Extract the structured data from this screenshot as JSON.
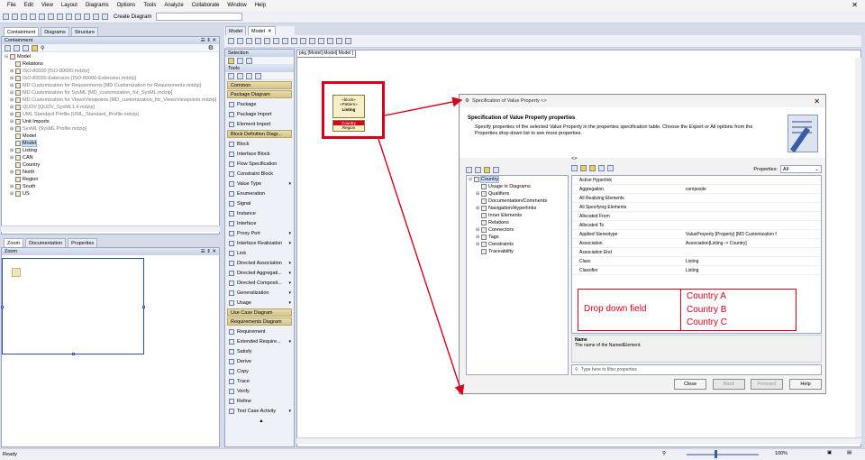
{
  "menu": [
    "File",
    "Edit",
    "View",
    "Layout",
    "Diagrams",
    "Options",
    "Tools",
    "Analyze",
    "Collaborate",
    "Window",
    "Help"
  ],
  "toolbar": {
    "create_diagram": "Create Diagram"
  },
  "left_tabs": [
    "Containment",
    "Diagrams",
    "Structure"
  ],
  "containment": {
    "title": "Containment",
    "tree": [
      {
        "label": "Model",
        "level": 0,
        "expander": "⊟"
      },
      {
        "label": "Relations",
        "level": 1,
        "expander": ""
      },
      {
        "label": "ISO-80000 [ISO-80000.mdzip]",
        "level": 1,
        "expander": "⊞",
        "gray": true
      },
      {
        "label": "ISO-80000-Extension [ISO-80000-Extension.mdzip]",
        "level": 1,
        "expander": "⊞",
        "gray": true
      },
      {
        "label": "MD Customization for Requirements [MD Customization for Requirements.mdzip]",
        "level": 1,
        "expander": "⊞",
        "gray": true
      },
      {
        "label": "MD Customization for SysML [MD_customization_for_SysML.mdzip]",
        "level": 1,
        "expander": "⊞",
        "gray": true
      },
      {
        "label": "MD Customization for ViewsViewpoints [MD_customization_for_ViewsViewpoints.mdzip]",
        "level": 1,
        "expander": "⊞",
        "gray": true
      },
      {
        "label": "QUDV [QUDV_SysML1.4.mdzip]",
        "level": 1,
        "expander": "⊞",
        "gray": true
      },
      {
        "label": "UML Standard Profile [UML_Standard_Profile.mdzip]",
        "level": 1,
        "expander": "⊞",
        "gray": true
      },
      {
        "label": "Unit Imports",
        "level": 1,
        "expander": "⊞"
      },
      {
        "label": "SysML [SysML Profile.mdzip]",
        "level": 1,
        "expander": "⊞",
        "gray": true
      },
      {
        "label": "Model",
        "level": 1,
        "expander": ""
      },
      {
        "label": "Model",
        "level": 1,
        "expander": "",
        "selected": true
      },
      {
        "label": "Listing",
        "level": 1,
        "expander": "⊞"
      },
      {
        "label": "CAN",
        "level": 1,
        "expander": "⊞"
      },
      {
        "label": "Country",
        "level": 1,
        "expander": ""
      },
      {
        "label": "North",
        "level": 1,
        "expander": "⊞"
      },
      {
        "label": "Region",
        "level": 1,
        "expander": ""
      },
      {
        "label": "South",
        "level": 1,
        "expander": "⊞"
      },
      {
        "label": "US",
        "level": 1,
        "expander": "⊞"
      }
    ]
  },
  "zoom_tabs": [
    "Zoom",
    "Documentation",
    "Properties"
  ],
  "zoom_panel": {
    "title": "Zoom"
  },
  "tools": {
    "selection_header": "Selection",
    "tools_header": "Tools",
    "items": [
      {
        "kind": "cat",
        "label": "Common"
      },
      {
        "kind": "cat",
        "label": "Package Diagram"
      },
      {
        "kind": "item",
        "label": "Package"
      },
      {
        "kind": "item",
        "label": "Package Import"
      },
      {
        "kind": "item",
        "label": "Element Import"
      },
      {
        "kind": "cat",
        "label": "Block Definition Diagr..."
      },
      {
        "kind": "item",
        "label": "Block"
      },
      {
        "kind": "item",
        "label": "Interface Block"
      },
      {
        "kind": "item",
        "label": "Flow Specification"
      },
      {
        "kind": "item",
        "label": "Constraint Block"
      },
      {
        "kind": "item",
        "label": "Value Type",
        "dd": true
      },
      {
        "kind": "item",
        "label": "Enumeration"
      },
      {
        "kind": "item",
        "label": "Signal"
      },
      {
        "kind": "item",
        "label": "Instance"
      },
      {
        "kind": "item",
        "label": "Interface"
      },
      {
        "kind": "item",
        "label": "Proxy Port",
        "dd": true
      },
      {
        "kind": "item",
        "label": "Interface Realization",
        "dd": true
      },
      {
        "kind": "item",
        "label": "Link"
      },
      {
        "kind": "item",
        "label": "Directed Association",
        "dd": true
      },
      {
        "kind": "item",
        "label": "Directed Aggregati...",
        "dd": true
      },
      {
        "kind": "item",
        "label": "Directed Composit...",
        "dd": true
      },
      {
        "kind": "item",
        "label": "Generalization",
        "dd": true
      },
      {
        "kind": "item",
        "label": "Usage",
        "dd": true
      },
      {
        "kind": "cat",
        "label": "Use Case Diagram"
      },
      {
        "kind": "cat",
        "label": "Requirements Diagram"
      },
      {
        "kind": "item",
        "label": "Requirement"
      },
      {
        "kind": "item",
        "label": "Extended Require...",
        "dd": true
      },
      {
        "kind": "item",
        "label": "Satisfy"
      },
      {
        "kind": "item",
        "label": "Derive"
      },
      {
        "kind": "item",
        "label": "Copy"
      },
      {
        "kind": "item",
        "label": "Trace"
      },
      {
        "kind": "item",
        "label": "Verify"
      },
      {
        "kind": "item",
        "label": "Refine"
      },
      {
        "kind": "item",
        "label": "Test Case Activity",
        "dd": true
      }
    ]
  },
  "doc_tabs": [
    "Model",
    "Model"
  ],
  "canvas": {
    "pkg_label": "pkg [Model] Model[ Model ]",
    "block1": {
      "stereo1": "«block»",
      "stereo2": "«Pattern»",
      "name": "Listing"
    },
    "block2": {
      "line1": "Country",
      "line2": "Region"
    }
  },
  "dialog": {
    "title": "Specification of Value Property <>",
    "heading": "Specification of Value Property properties",
    "description": "Specify properties of the selected Value Property in the properties specification table. Choose the Expert or All options from the Properties drop-down list to see more properties.",
    "breadcrumb": "<>",
    "properties_label": "Properties:",
    "properties_value": "All",
    "tree": [
      {
        "label": "Country",
        "selected": true,
        "exp": "⊟"
      },
      {
        "label": "Usage in Diagrams",
        "exp": ""
      },
      {
        "label": "Qualifiers",
        "exp": "⊞"
      },
      {
        "label": "Documentation/Comments",
        "exp": ""
      },
      {
        "label": "Navigation/Hyperlinks",
        "exp": "⊞"
      },
      {
        "label": "Inner Elements",
        "exp": ""
      },
      {
        "label": "Relations",
        "exp": ""
      },
      {
        "label": "Connectors",
        "exp": "⊞"
      },
      {
        "label": "Tags",
        "exp": "⊞"
      },
      {
        "label": "Constraints",
        "exp": "⊞"
      },
      {
        "label": "Traceability",
        "exp": ""
      }
    ],
    "props": [
      {
        "k": "Active Hyperlink",
        "v": ""
      },
      {
        "k": "Aggregation",
        "v": "composite"
      },
      {
        "k": "All Realizing Elements",
        "v": ""
      },
      {
        "k": "All Specifying Elements",
        "v": ""
      },
      {
        "k": "Allocated From",
        "v": ""
      },
      {
        "k": "Allocated To",
        "v": ""
      },
      {
        "k": "Applied Stereotype",
        "v": "ValueProperty [Property] [MD Customization f"
      },
      {
        "k": "Association",
        "v": "Association[Listing -> Country]"
      },
      {
        "k": "Association End",
        "v": ""
      },
      {
        "k": "Class",
        "v": "Listing"
      },
      {
        "k": "Classifier",
        "v": "Listing"
      }
    ],
    "desc_name": "Name",
    "desc_text": "The name of the NamedElement.",
    "search_placeholder": "Type here to filter properties",
    "buttons": {
      "close": "Close",
      "back": "Back",
      "forward": "Forward",
      "help": "Help"
    }
  },
  "annotation": {
    "label": "Drop down field",
    "options": [
      "Country A",
      "Country B",
      "Country C"
    ]
  },
  "status": {
    "ready": "Ready",
    "zoom": "100%"
  },
  "colors": {
    "highlight_red": "#d9001b"
  }
}
